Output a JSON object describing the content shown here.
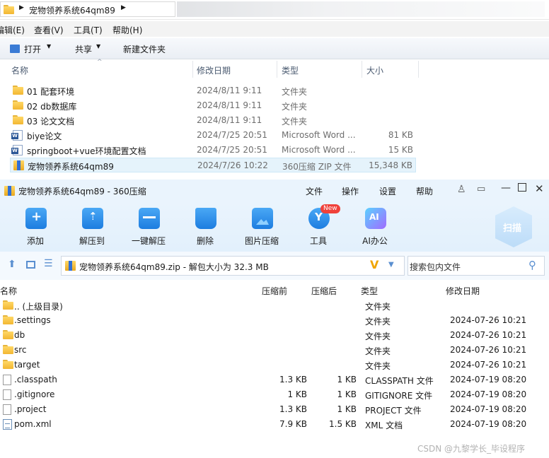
{
  "explorer": {
    "breadcrumb": "宠物领养系统64qm89",
    "menu": [
      "编辑(E)",
      "查看(V)",
      "工具(T)",
      "帮助(H)"
    ],
    "toolbar": {
      "open": "打开",
      "share": "共享",
      "new_folder": "新建文件夹"
    },
    "columns": [
      "名称",
      "修改日期",
      "类型",
      "大小"
    ],
    "rows": [
      {
        "name": "01 配套环境",
        "date": "2024/8/11 9:11",
        "type": "文件夹",
        "size": "",
        "icon": "folder-icon"
      },
      {
        "name": "02 db数据库",
        "date": "2024/8/11 9:11",
        "type": "文件夹",
        "size": "",
        "icon": "folder-icon"
      },
      {
        "name": "03 论文文档",
        "date": "2024/8/11 9:11",
        "type": "文件夹",
        "size": "",
        "icon": "folder-icon"
      },
      {
        "name": "biye论文",
        "date": "2024/7/25 20:51",
        "type": "Microsoft Word ...",
        "size": "81 KB",
        "icon": "word-doc-icon"
      },
      {
        "name": "springboot+vue环境配置文档",
        "date": "2024/7/25 20:51",
        "type": "Microsoft Word ...",
        "size": "15 KB",
        "icon": "word-doc-icon"
      },
      {
        "name": "宠物领养系统64qm89",
        "date": "2024/7/26 10:22",
        "type": "360压缩 ZIP 文件",
        "size": "15,348 KB",
        "icon": "zip-archive-icon"
      }
    ]
  },
  "zip": {
    "title": "宠物领养系统64qm89 - 360压缩",
    "top_menu": [
      "文件",
      "操作",
      "设置",
      "帮助"
    ],
    "ribbon": [
      "添加",
      "解压到",
      "一键解压",
      "删除",
      "图片压缩",
      "工具",
      "AI办公"
    ],
    "new_badge": "New",
    "scan_label": "扫描",
    "path": "宠物领养系统64qm89.zip - 解包大小为 32.3 MB",
    "search_placeholder": "搜索包内文件",
    "columns": [
      "名称",
      "压缩前",
      "压缩后",
      "类型",
      "修改日期"
    ],
    "rows": [
      {
        "name": ".. (上级目录)",
        "before": "",
        "after": "",
        "type": "文件夹",
        "date": "",
        "icon": "folder-icon"
      },
      {
        "name": ".settings",
        "before": "",
        "after": "",
        "type": "文件夹",
        "date": "2024-07-26 10:21",
        "icon": "folder-icon"
      },
      {
        "name": "db",
        "before": "",
        "after": "",
        "type": "文件夹",
        "date": "2024-07-26 10:21",
        "icon": "folder-icon"
      },
      {
        "name": "src",
        "before": "",
        "after": "",
        "type": "文件夹",
        "date": "2024-07-26 10:21",
        "icon": "folder-icon"
      },
      {
        "name": "target",
        "before": "",
        "after": "",
        "type": "文件夹",
        "date": "2024-07-26 10:21",
        "icon": "folder-icon"
      },
      {
        "name": ".classpath",
        "before": "1.3 KB",
        "after": "1 KB",
        "type": "CLASSPATH 文件",
        "date": "2024-07-19 08:20",
        "icon": "file-icon"
      },
      {
        "name": ".gitignore",
        "before": "1 KB",
        "after": "1 KB",
        "type": "GITIGNORE 文件",
        "date": "2024-07-19 08:20",
        "icon": "file-icon"
      },
      {
        "name": ".project",
        "before": "1.3 KB",
        "after": "1 KB",
        "type": "PROJECT 文件",
        "date": "2024-07-19 08:20",
        "icon": "file-icon"
      },
      {
        "name": "pom.xml",
        "before": "7.9 KB",
        "after": "1.5 KB",
        "type": "XML 文档",
        "date": "2024-07-19 08:20",
        "icon": "xml-file-icon"
      }
    ]
  },
  "watermark": "CSDN @九黎学长_毕设程序",
  "colors": {
    "accent": "#1d7de0",
    "selection": "#e5f3fb",
    "zip_bg": "#eaf4fd"
  }
}
